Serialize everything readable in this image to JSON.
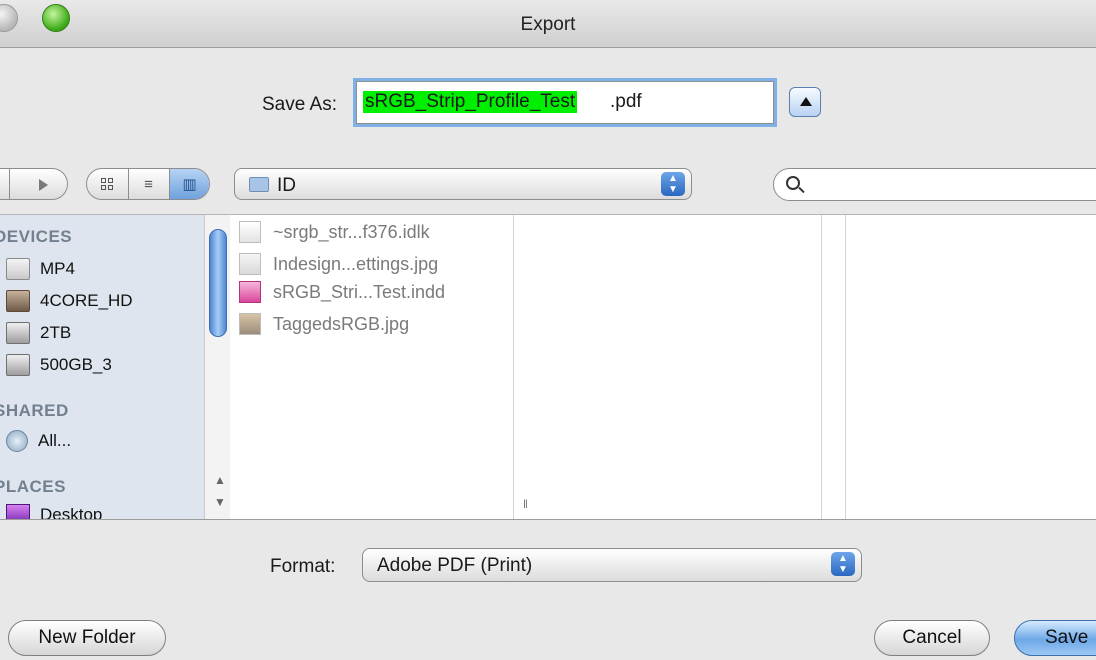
{
  "window": {
    "title": "Export"
  },
  "save_as": {
    "label": "Save As:",
    "selected_part": "sRGB_Strip_Profile_Test",
    "extension": ".pdf"
  },
  "toolbar": {
    "location": "ID",
    "search_value": ""
  },
  "sidebar": {
    "sections": [
      {
        "heading": "DEVICES",
        "items": [
          {
            "label": "MP4",
            "icon": "drive-icon"
          },
          {
            "label": "4CORE_HD",
            "icon": "hard-disk-icon"
          },
          {
            "label": "2TB",
            "icon": "external-drive-icon"
          },
          {
            "label": "500GB_3",
            "icon": "external-drive-icon"
          }
        ]
      },
      {
        "heading": "SHARED",
        "items": [
          {
            "label": "All...",
            "icon": "network-icon"
          }
        ]
      },
      {
        "heading": "PLACES",
        "items": [
          {
            "label": "Desktop",
            "icon": "desktop-icon"
          }
        ]
      }
    ]
  },
  "files": [
    {
      "name": "~srgb_str...f376.idlk",
      "icon": "lock-file-icon"
    },
    {
      "name": "Indesign...ettings.jpg",
      "icon": "jpg-file-icon"
    },
    {
      "name": "sRGB_Stri...Test.indd",
      "icon": "indesign-file-icon"
    },
    {
      "name": "TaggedsRGB.jpg",
      "icon": "image-file-icon"
    }
  ],
  "format": {
    "label": "Format:",
    "value": "Adobe PDF (Print)"
  },
  "buttons": {
    "new_folder": "New Folder",
    "cancel": "Cancel",
    "save": "Save"
  }
}
